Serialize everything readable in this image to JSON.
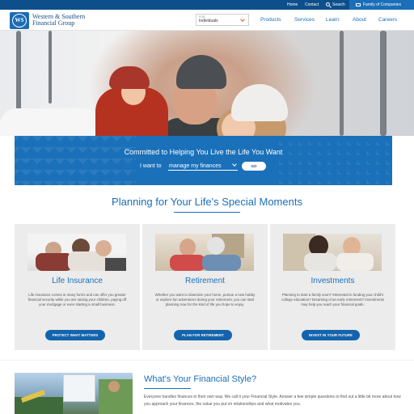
{
  "utility_bar": {
    "links": [
      "Home",
      "Contact",
      "Search"
    ],
    "family_label": "Family of Companies"
  },
  "header": {
    "brand_line1": "Western & Southern",
    "brand_line2": "Financial Group",
    "logo_text": "WS",
    "for_label": "FOR",
    "for_value": "Individuals",
    "nav": [
      "Products",
      "Services",
      "Learn",
      "About",
      "Careers"
    ]
  },
  "promo": {
    "title": "Committed to Helping You Live the Life You Want",
    "i_want": "I want to",
    "select_value": "manage my finances",
    "go_label": "GO"
  },
  "section": {
    "title": "Planning for Your Life's Special Moments"
  },
  "cards": [
    {
      "title": "Life Insurance",
      "body": "Life insurance comes in many forms and can offer you greater financial security while you are raising your children, paying off your mortgage or even starting a small business.",
      "button": "PROTECT WHAT MATTERS"
    },
    {
      "title": "Retirement",
      "body": "Whether you want to downsize your home, pursue a new hobby or explore fun adventures during your retirement, you can start planning now for the kind of life you hope to enjoy.",
      "button": "PLAN FOR RETIREMENT"
    },
    {
      "title": "Investments",
      "body": "Planning to start a family soon? Interested in funding your child's college education? Dreaming of an early retirement? Investments may help you reach your financial goals.",
      "button": "INVEST IN YOUR FUTURE"
    }
  ],
  "financial_style": {
    "title": "What's Your Financial Style?",
    "body": "Everyone handles finances in their own way. We call it your Financial Style. Answer a few simple questions to find out a little bit more about how you approach your finances, the value you put on relationships and what motivates you."
  },
  "colors": {
    "brand_blue": "#1a6fb8",
    "dark_blue": "#0d4f8b",
    "button_blue": "#1464ad",
    "accent_orange": "#e25c1b",
    "card_gray": "#ececec"
  }
}
